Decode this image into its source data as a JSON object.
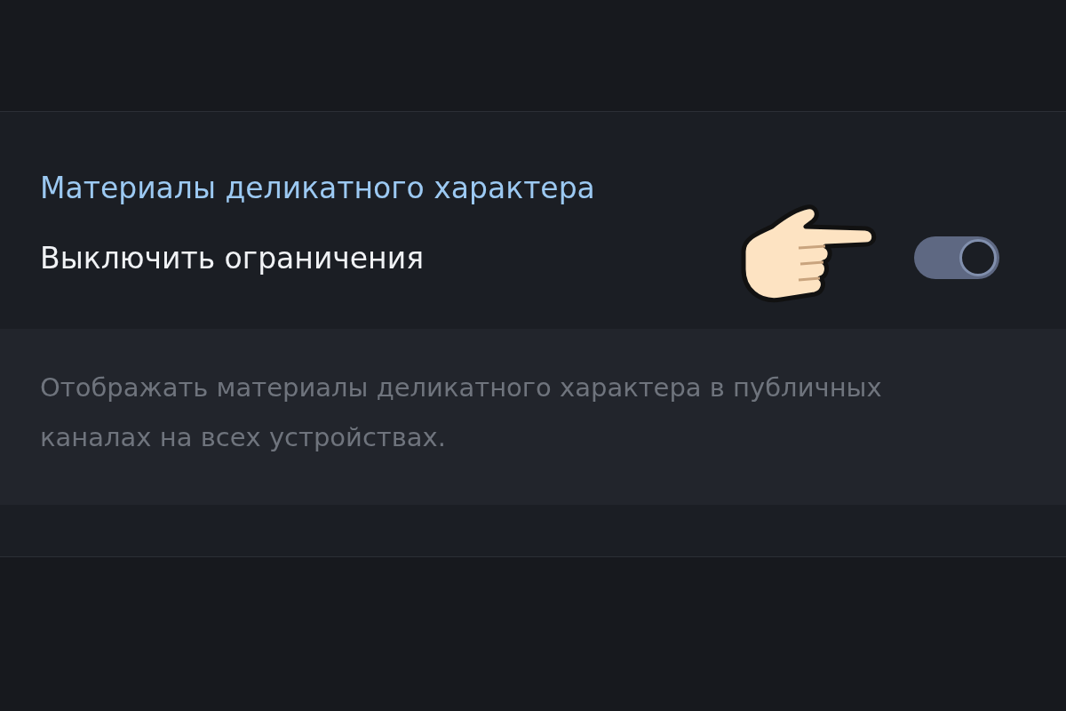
{
  "section": {
    "title": "Материалы деликатного характера",
    "setting": {
      "label": "Выключить ограничения",
      "on": true
    },
    "description": "Отображать материалы деликатного характера в публичных каналах на всех устройствах."
  }
}
